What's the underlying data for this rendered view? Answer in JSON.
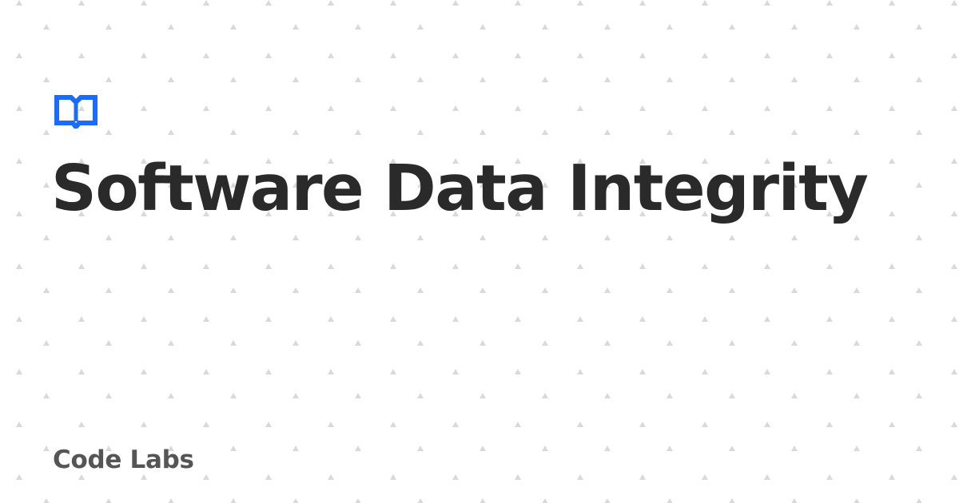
{
  "card": {
    "title": "Software Data Integrity",
    "brand": "Code Labs",
    "logo_icon": "book-icon"
  },
  "colors": {
    "background": "#ffffff",
    "accent": "#1a6cff",
    "title": "#2a2a2a",
    "brand": "#555555",
    "pattern": "#d9d9d9"
  }
}
